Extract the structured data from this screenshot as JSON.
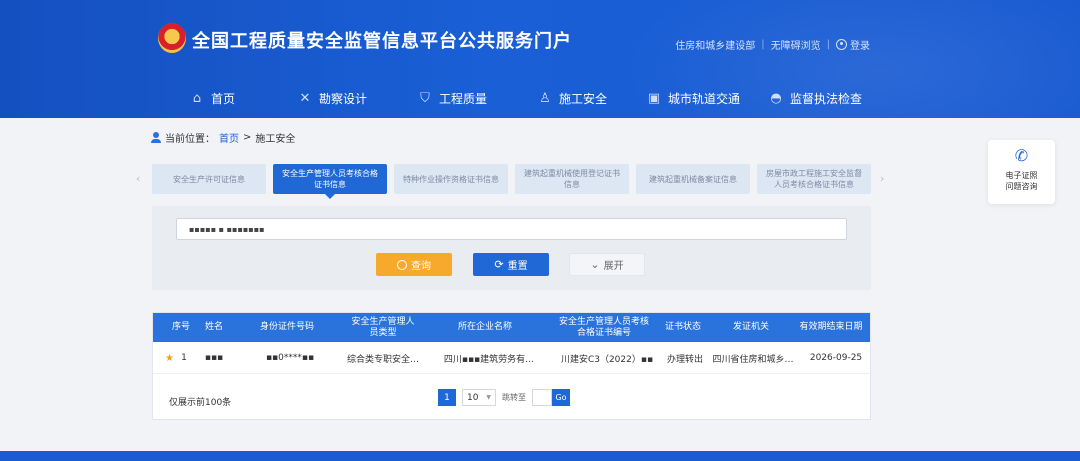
{
  "header": {
    "title": "全国工程质量安全监管信息平台公共服务门户",
    "links": [
      "住房和城乡建设部",
      "无障碍浏览"
    ],
    "login": "登录"
  },
  "nav": {
    "items": [
      {
        "label": "首页",
        "icon": "home-icon"
      },
      {
        "label": "勘察设计",
        "icon": "tools-icon"
      },
      {
        "label": "工程质量",
        "icon": "shield-icon"
      },
      {
        "label": "施工安全",
        "icon": "worker-icon"
      },
      {
        "label": "城市轨道交通",
        "icon": "train-icon"
      },
      {
        "label": "监督执法检查",
        "icon": "police-cap-icon"
      }
    ]
  },
  "breadcrumb": {
    "prefix": "当前位置：",
    "home": "首页",
    "separator": ">",
    "current": "施工安全"
  },
  "tabs": [
    {
      "label": "安全生产许可证信息",
      "active": false
    },
    {
      "label": "安全生产管理人员考核合格证书信息",
      "active": true
    },
    {
      "label": "特种作业操作资格证书信息",
      "active": false
    },
    {
      "label": "建筑起重机械使用登记证书信息",
      "active": false
    },
    {
      "label": "建筑起重机械备案证信息",
      "active": false
    },
    {
      "label": "房屋市政工程施工安全监督人员考核合格证书信息",
      "active": false
    }
  ],
  "search": {
    "value": "▪︎▪︎▪︎▪︎▪︎ ▪︎ ▪︎▪︎▪︎▪︎▪︎▪︎▪︎",
    "query_label": "查询",
    "reset_label": "重置",
    "expand_label": "展开"
  },
  "table": {
    "headers": [
      "序号",
      "姓名",
      "身份证件号码",
      "安全生产管理人员类型",
      "所在企业名称",
      "安全生产管理人员考核合格证书编号",
      "证书状态",
      "发证机关",
      "有效期结束日期"
    ],
    "rows": [
      {
        "index": "1",
        "name": "▪︎▪︎▪︎",
        "id_number": "▪︎▪︎0****▪︎▪︎",
        "type": "综合类专职安全…",
        "company": "四川▪︎▪︎▪︎建筑劳务有…",
        "cert_no": "川建安C3（2022）▪︎▪︎",
        "status": "办理转出",
        "issuer": "四川省住房和城乡…",
        "end_date": "2026-09-25"
      }
    ],
    "note": "仅展示前100条"
  },
  "pagination": {
    "current_page": "1",
    "page_size": "10",
    "jump_label": "跳转至",
    "go_label": "Go"
  },
  "side_widget": {
    "line1": "电子证照",
    "line2": "问题咨询"
  },
  "colors": {
    "brand_blue": "#1f68d6",
    "accent_orange": "#f6a92a"
  }
}
